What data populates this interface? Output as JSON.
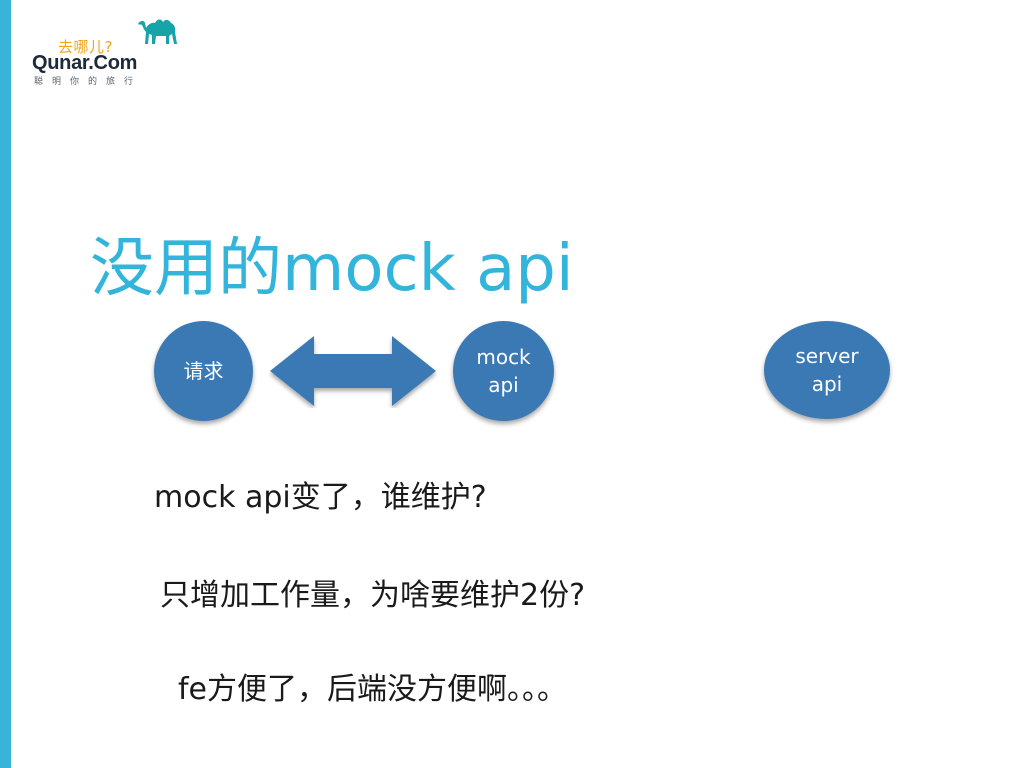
{
  "logo": {
    "cn_text": "去哪儿?",
    "brand": "Qunar.Com",
    "slogan": "聪明你的旅行",
    "icon": "camel-icon"
  },
  "slide": {
    "title": "没用的mock api",
    "colors": {
      "stripe": "#3ab3d9",
      "title": "#33b4db",
      "node": "#3a79b4",
      "logo_accent": "#f2a51a"
    }
  },
  "diagram": {
    "nodes": [
      {
        "label": "请求"
      },
      {
        "label": "mock\napi"
      },
      {
        "label": "server\napi"
      }
    ],
    "arrow": "double-headed-arrow"
  },
  "body": {
    "lines": [
      "mock api变了，谁维护?",
      "只增加工作量，为啥要维护2份?",
      "fe方便了，后端没方便啊。。。"
    ]
  }
}
